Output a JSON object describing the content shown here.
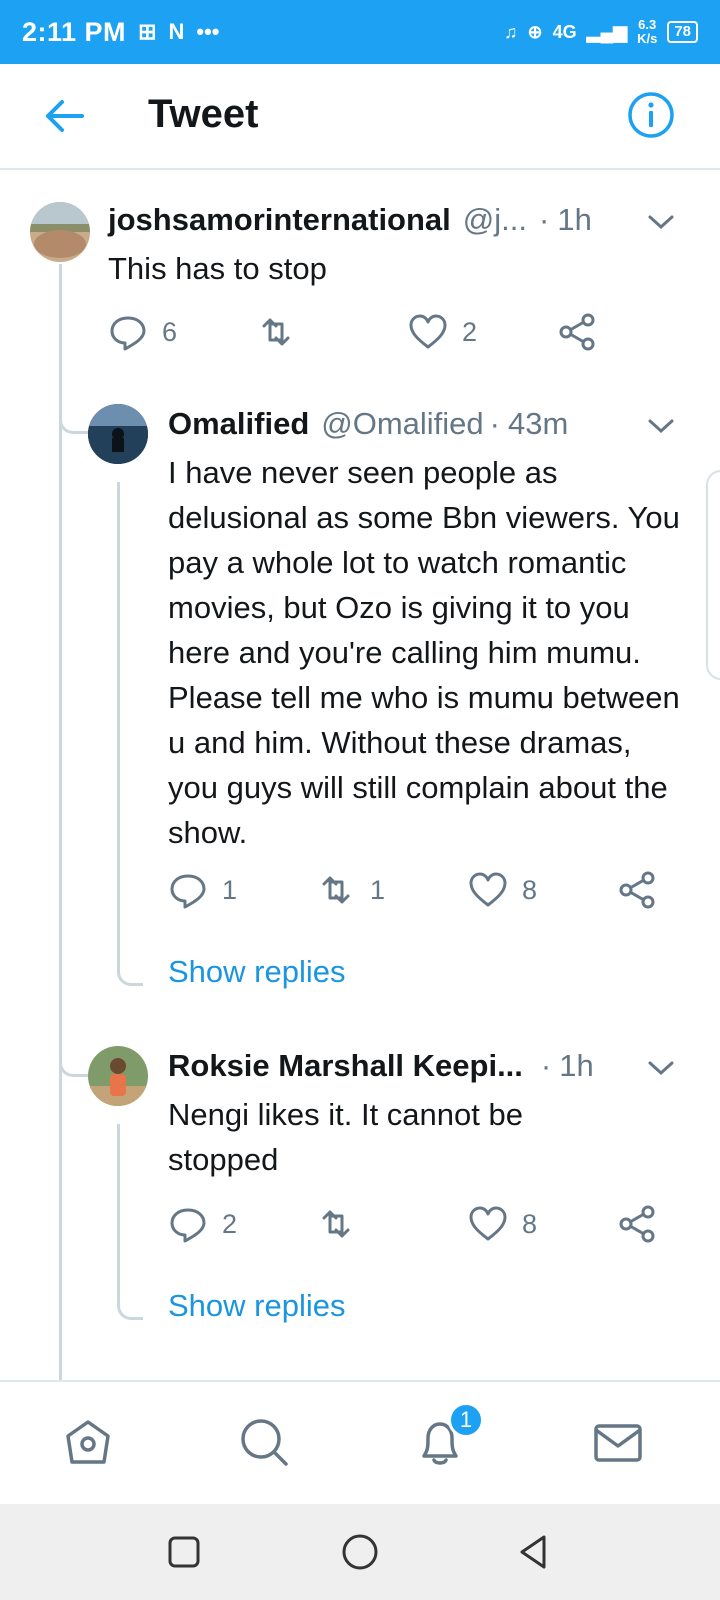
{
  "status_bar": {
    "time": "2:11 PM",
    "network_type": "4G",
    "speed_value": "6.3",
    "speed_unit": "K/s",
    "battery": "78"
  },
  "app_bar": {
    "title": "Tweet"
  },
  "tweets": [
    {
      "name": "joshsamorinternational",
      "handle": "@j...",
      "time": "1h",
      "text": "This has to stop",
      "replies": "6",
      "retweets": "",
      "likes": "2"
    },
    {
      "name": "Omalified",
      "handle": "@Omalified",
      "time": "43m",
      "text": "I have never seen people as delusional as some Bbn viewers. You pay a whole lot to watch romantic movies, but Ozo is giving it to you here and you're calling him mumu. Please tell me who is mumu between u and him. Without these dramas, you guys will still complain about the show.",
      "replies": "1",
      "retweets": "1",
      "likes": "8",
      "show_replies": "Show replies"
    },
    {
      "name": "Roksie Marshall Keepi...",
      "handle": "",
      "time": "1h",
      "text": "Nengi likes it. It cannot be stopped",
      "replies": "2",
      "retweets": "",
      "likes": "8",
      "show_replies": "Show replies"
    }
  ],
  "bottom_nav": {
    "notification_badge": "1"
  },
  "colors": {
    "accent": "#1da1f2",
    "link": "#1b95e0",
    "secondary_text": "#657786",
    "thread_line": "#ccd6dd"
  }
}
